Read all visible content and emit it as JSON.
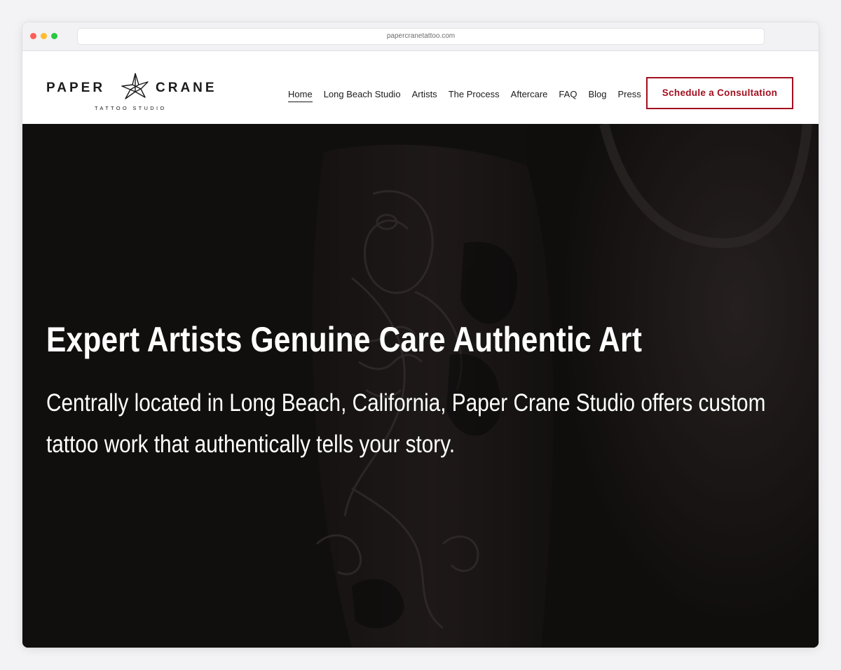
{
  "browser": {
    "url": "papercranetattoo.com"
  },
  "logo": {
    "word_left": "PAPER",
    "word_right": "CRANE",
    "subtitle": "TATTOO STUDIO"
  },
  "nav": {
    "items": [
      {
        "label": "Home",
        "active": true
      },
      {
        "label": "Long Beach Studio",
        "active": false
      },
      {
        "label": "Artists",
        "active": false
      },
      {
        "label": "The Process",
        "active": false
      },
      {
        "label": "Aftercare",
        "active": false
      },
      {
        "label": "FAQ",
        "active": false
      },
      {
        "label": "Blog",
        "active": false
      },
      {
        "label": "Press",
        "active": false
      }
    ]
  },
  "cta": {
    "label": "Schedule a Consultation"
  },
  "hero": {
    "title": "Expert Artists Genuine Care Authentic Art",
    "text": "Centrally located in Long Beach, California, Paper Crane Studio offers custom tattoo work that authentically tells your story."
  },
  "colors": {
    "accent": "#a30f1f",
    "hero_overlay": "#1c1817",
    "text_dark": "#1b1b1b"
  },
  "icons": {
    "logo_mark": "origami-crane-icon"
  }
}
